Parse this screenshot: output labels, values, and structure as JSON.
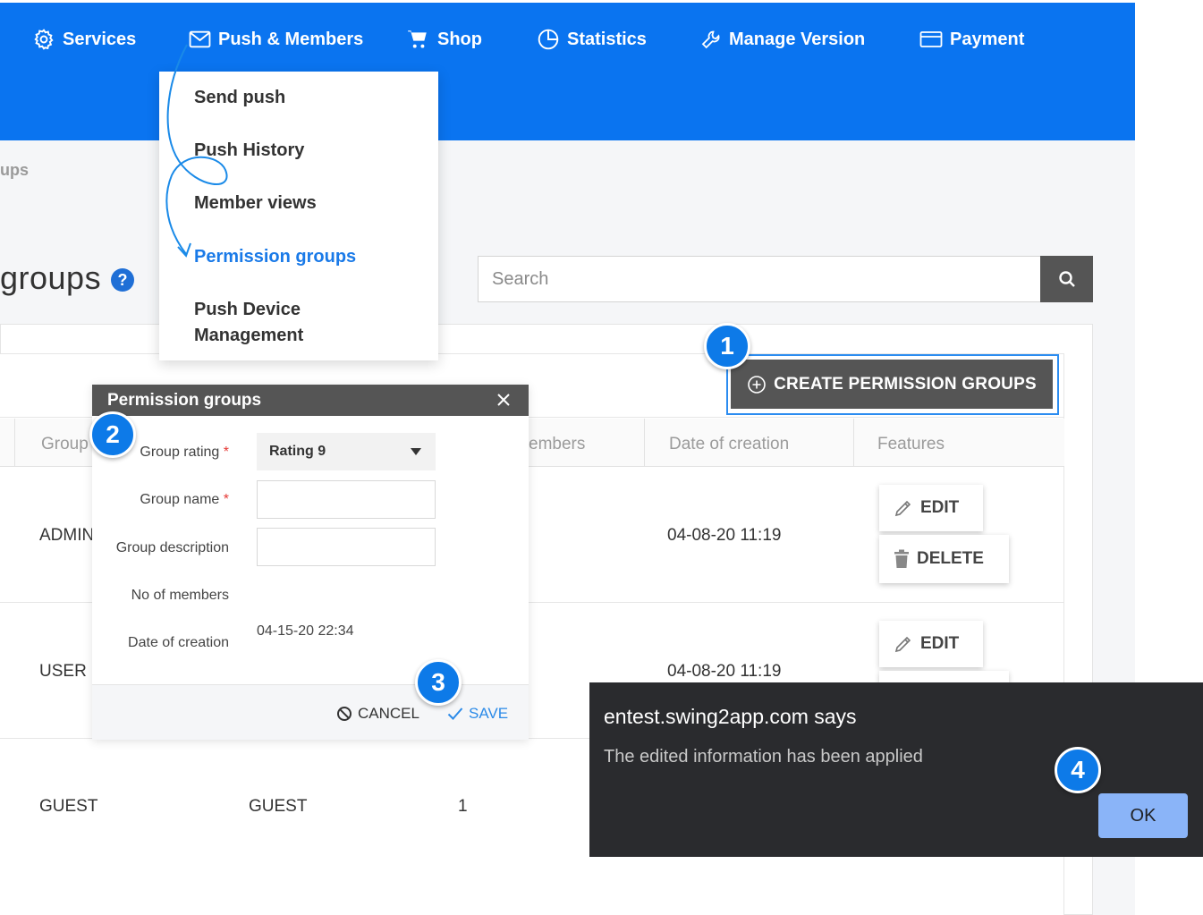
{
  "nav": {
    "items": [
      {
        "label": "Services",
        "icon": "gear-icon"
      },
      {
        "label": "Push & Members",
        "icon": "envelope-icon"
      },
      {
        "label": "Shop",
        "icon": "cart-icon"
      },
      {
        "label": "Statistics",
        "icon": "pie-chart-icon"
      },
      {
        "label": "Manage Version",
        "icon": "wrench-icon"
      },
      {
        "label": "Payment",
        "icon": "credit-card-icon"
      }
    ]
  },
  "breadcrumb": "ups",
  "page": {
    "title": "groups",
    "help": "?"
  },
  "search": {
    "placeholder": "Search"
  },
  "dropdown": {
    "items": [
      "Send push",
      "Push History",
      "Member views",
      "Permission groups",
      "Push Device",
      "Management"
    ],
    "active": "Permission groups"
  },
  "toolbar": {
    "create_label": "CREATE PERMISSION GROUPS"
  },
  "table": {
    "headers": [
      "Group",
      "embers",
      "Date of creation",
      "Features"
    ],
    "rows": [
      {
        "group": "ADMIN",
        "name": "",
        "members": "",
        "date": "04-08-20 11:19"
      },
      {
        "group": "USER",
        "name": "",
        "members": "",
        "date": "04-08-20 11:19"
      },
      {
        "group": "GUEST",
        "name": "GUEST",
        "members": "1",
        "date": ""
      }
    ],
    "edit_label": "EDIT",
    "delete_label": "DELETE"
  },
  "dialog": {
    "title": "Permission groups",
    "fields": {
      "rating_label": "Group rating",
      "rating_value": "Rating 9",
      "name_label": "Group name",
      "desc_label": "Group description",
      "members_label": "No of members",
      "date_label": "Date of creation",
      "date_value": "04-15-20 22:34",
      "required_mark": "*"
    },
    "cancel_label": "CANCEL",
    "save_label": "SAVE"
  },
  "alert": {
    "origin": "entest.swing2app.com says",
    "message": "The edited information has been applied",
    "ok_label": "OK"
  },
  "steps": [
    "1",
    "2",
    "3",
    "4"
  ],
  "colors": {
    "nav_blue": "#0a74f0",
    "step_blue": "#0d7ae8",
    "active_link": "#1a7ae8",
    "dark_button": "#555555",
    "alert_bg": "#2a2b2e",
    "alert_ok": "#8ab4f8",
    "required": "#e53935"
  }
}
